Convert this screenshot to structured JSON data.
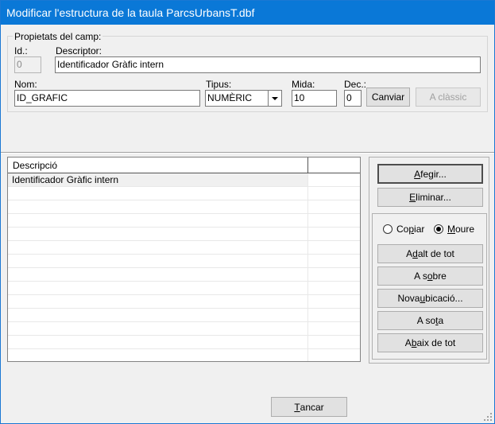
{
  "window": {
    "title": "Modificar l'estructura de la taula ParcsUrbansT.dbf"
  },
  "field_props": {
    "group_label": "Propietats del camp:",
    "id_label": "Id.:",
    "id_value": "0",
    "descriptor_label": "Descriptor:",
    "descriptor_value": "Identificador Gràfic intern",
    "nom_label": "Nom:",
    "nom_value": "ID_GRAFIC",
    "tipus_label": "Tipus:",
    "tipus_value": "NUMÈRIC",
    "mida_label": "Mida:",
    "mida_value": "10",
    "dec_label": "Dec.:",
    "dec_value": "0",
    "canviar_label": "Canviar",
    "aclassic_label": "A clàssic"
  },
  "fields_table": {
    "columns": [
      "Descripció",
      ""
    ],
    "rows": [
      {
        "descripcio": "Identificador Gràfic intern",
        "extra": ""
      }
    ],
    "empty_rows": 13
  },
  "actions": {
    "afegir_pre": "",
    "afegir_key": "A",
    "afegir_post": "fegir...",
    "eliminar_pre": "",
    "eliminar_key": "E",
    "eliminar_post": "liminar..."
  },
  "move": {
    "copiar_pre": "Co",
    "copiar_key": "p",
    "copiar_post": "iar",
    "moure_pre": "",
    "moure_key": "M",
    "moure_post": "oure",
    "selected": "Moure",
    "dalt_pre": "A ",
    "dalt_key": "d",
    "dalt_post": "alt de tot",
    "sobre_pre": "A s",
    "sobre_key": "o",
    "sobre_post": "bre",
    "nova_pre": "Nova ",
    "nova_key": "u",
    "nova_post": "bicació...",
    "sota_pre": "A so",
    "sota_key": "t",
    "sota_post": "a",
    "baix_pre": "A ",
    "baix_key": "b",
    "baix_post": "aix de tot"
  },
  "footer": {
    "tancar_pre": "",
    "tancar_key": "T",
    "tancar_post": "ancar"
  }
}
